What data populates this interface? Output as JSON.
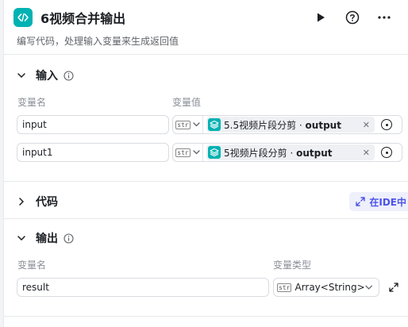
{
  "node": {
    "title": "6视频合并输出",
    "description": "编写代码，处理输入变量来生成返回值",
    "icon": "code-brackets-icon"
  },
  "header_actions": [
    "play-icon",
    "help-icon",
    "more-icon"
  ],
  "input_section": {
    "title": "输入",
    "col_name": "变量名",
    "col_value": "变量值",
    "rows": [
      {
        "name": "input",
        "type_badge": "str",
        "ref_node": "5.5视频片段分剪",
        "ref_sep": " · ",
        "ref_var": "output"
      },
      {
        "name": "input1",
        "type_badge": "str",
        "ref_node": "5视频片段分剪",
        "ref_sep": " · ",
        "ref_var": "output"
      }
    ]
  },
  "code_section": {
    "title": "代码",
    "ide_button": "在IDE中"
  },
  "output_section": {
    "title": "输出",
    "col_name": "变量名",
    "col_type": "变量类型",
    "rows": [
      {
        "name": "result",
        "type_badge": "str",
        "type": "Array<String>"
      }
    ]
  },
  "colors": {
    "accent": "#00b2b2",
    "ide_text": "#4d53e8",
    "ide_bg": "#eef0fc"
  }
}
